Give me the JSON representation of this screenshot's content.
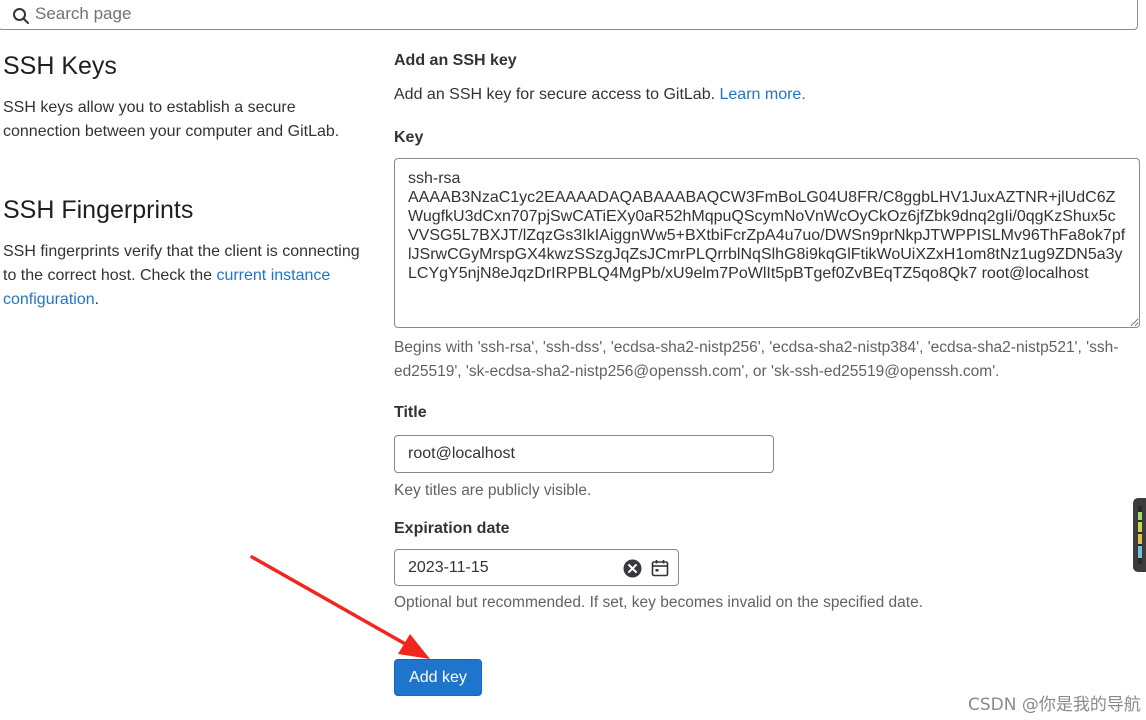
{
  "search": {
    "placeholder": "Search page"
  },
  "ssh_keys": {
    "title": "SSH Keys",
    "description": "SSH keys allow you to establish a secure connection between your computer and GitLab."
  },
  "fingerprints": {
    "title": "SSH Fingerprints",
    "description": "SSH fingerprints verify that the client is connecting to the correct host. Check the",
    "link": "current instance configuration",
    "suffix": "."
  },
  "form": {
    "heading": "Add an SSH key",
    "description": "Add an SSH key for secure access to GitLab.",
    "learn_more": "Learn more.",
    "key_label": "Key",
    "key_value": "ssh-rsa\nAAAAB3NzaC1yc2EAAAADAQABAAABAQCW3FmBoLG04U8FR/C8ggbLHV1JuxAZTNR+jlUdC6ZWugfkU3dCxn707pjSwCATiEXy0aR52hMqpuQScymNoVnWcOyCkOz6jfZbk9dnq2gIi/0qgKzShux5cVVSG5L7BXJT/lZqzGs3IkIAiggnWw5+BXtbiFcrZpA4u7uo/DWSn9prNkpJTWPPISLMv96ThFa8ok7pflJSrwCGyMrspGX4kwzSSzgJqZsJCmrPLQrrblNqSlhG8i9kqGlFtikWoUiXZxH1om8tNz1ug9ZDN5a3yLCYgY5njN8eJqzDrIRPBLQ4MgPb/xU9elm7PoWlIt5pBTgef0ZvBEqTZ5qo8Qk7 root@localhost",
    "key_help": "Begins with 'ssh-rsa', 'ssh-dss', 'ecdsa-sha2-nistp256', 'ecdsa-sha2-nistp384', 'ecdsa-sha2-nistp521', 'ssh-ed25519', 'sk-ecdsa-sha2-nistp256@openssh.com', or 'sk-ssh-ed25519@openssh.com'.",
    "title_label": "Title",
    "title_value": "root@localhost",
    "title_help": "Key titles are publicly visible.",
    "expiration_label": "Expiration date",
    "expiration_value": "2023-11-15",
    "expiration_help": "Optional but recommended. If set, key becomes invalid on the specified date.",
    "submit_label": "Add key"
  },
  "icons": {
    "search": "search-icon",
    "clear": "clear-icon",
    "calendar": "calendar-icon"
  },
  "colors": {
    "primary": "#1f75cb",
    "annotation_arrow": "#f2261e"
  },
  "watermark": "CSDN @你是我的导航"
}
